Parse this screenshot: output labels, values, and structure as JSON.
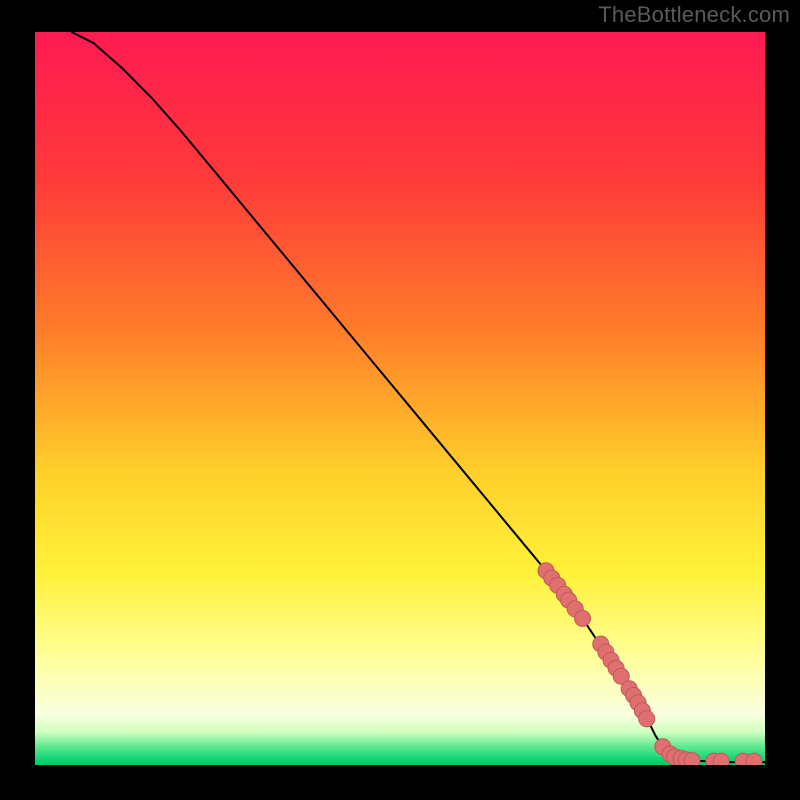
{
  "watermark": "TheBottleneck.com",
  "colors": {
    "background": "#000000",
    "curve_stroke": "#000000",
    "marker_fill": "#e07070",
    "marker_stroke": "#c05858",
    "gradient_stops": [
      {
        "offset": 0.0,
        "color": "#ff1a52"
      },
      {
        "offset": 0.2,
        "color": "#ff3a3a"
      },
      {
        "offset": 0.4,
        "color": "#ff7a2a"
      },
      {
        "offset": 0.6,
        "color": "#ffcf2a"
      },
      {
        "offset": 0.74,
        "color": "#fff23a"
      },
      {
        "offset": 0.86,
        "color": "#ffffa0"
      },
      {
        "offset": 0.93,
        "color": "#f8ffe0"
      },
      {
        "offset": 0.955,
        "color": "#d0ffc0"
      },
      {
        "offset": 0.975,
        "color": "#60e890"
      },
      {
        "offset": 0.99,
        "color": "#18d878"
      },
      {
        "offset": 1.0,
        "color": "#00c868"
      }
    ]
  },
  "chart_data": {
    "type": "line",
    "title": "",
    "xlabel": "",
    "ylabel": "",
    "xlim": [
      0,
      100
    ],
    "ylim": [
      0,
      100
    ],
    "series": [
      {
        "name": "curve",
        "x": [
          5,
          8,
          12,
          16,
          20,
          25,
          30,
          35,
          40,
          45,
          50,
          55,
          60,
          65,
          70,
          75,
          80,
          82,
          84,
          85,
          86,
          88,
          90,
          92,
          94,
          96,
          98,
          100
        ],
        "values": [
          100,
          98.5,
          95,
          91,
          86.5,
          80.5,
          74.5,
          68.5,
          62.5,
          56.5,
          50.5,
          44.5,
          38.5,
          32.5,
          26.5,
          20,
          12.5,
          9.5,
          6,
          4,
          2.5,
          1.0,
          0.6,
          0.5,
          0.4,
          0.4,
          0.4,
          0.4
        ]
      }
    ],
    "markers": [
      {
        "x": 70.0,
        "y": 26.5
      },
      {
        "x": 70.8,
        "y": 25.5
      },
      {
        "x": 71.6,
        "y": 24.5
      },
      {
        "x": 72.5,
        "y": 23.3
      },
      {
        "x": 73.1,
        "y": 22.5
      },
      {
        "x": 74.0,
        "y": 21.3
      },
      {
        "x": 75.0,
        "y": 20.0
      },
      {
        "x": 77.5,
        "y": 16.5
      },
      {
        "x": 78.2,
        "y": 15.4
      },
      {
        "x": 78.9,
        "y": 14.3
      },
      {
        "x": 79.6,
        "y": 13.2
      },
      {
        "x": 80.3,
        "y": 12.1
      },
      {
        "x": 81.4,
        "y": 10.4
      },
      {
        "x": 82.0,
        "y": 9.5
      },
      {
        "x": 82.6,
        "y": 8.5
      },
      {
        "x": 83.2,
        "y": 7.4
      },
      {
        "x": 83.8,
        "y": 6.3
      },
      {
        "x": 86.0,
        "y": 2.5
      },
      {
        "x": 87.0,
        "y": 1.5
      },
      {
        "x": 87.6,
        "y": 1.1
      },
      {
        "x": 88.5,
        "y": 0.9
      },
      {
        "x": 89.2,
        "y": 0.7
      },
      {
        "x": 90.0,
        "y": 0.6
      },
      {
        "x": 93.0,
        "y": 0.5
      },
      {
        "x": 94.0,
        "y": 0.5
      },
      {
        "x": 97.0,
        "y": 0.5
      },
      {
        "x": 98.5,
        "y": 0.5
      }
    ]
  }
}
